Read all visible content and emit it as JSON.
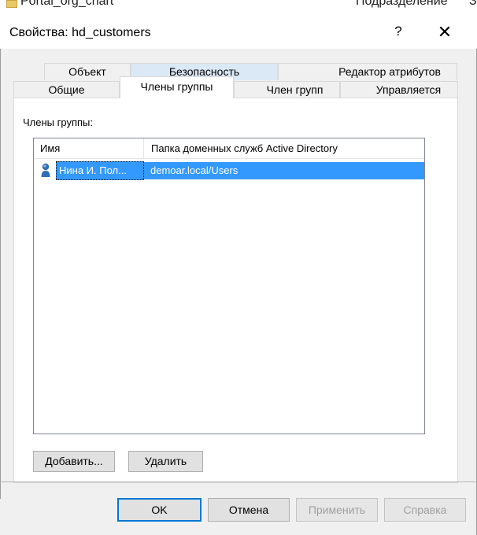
{
  "background_window": {
    "left_text": "Portal_org_chart",
    "right_text": "Подразделение",
    "right_text_2": "Зt"
  },
  "dialog": {
    "title": "Свойства: hd_customers",
    "help_label": "?",
    "close_label": "✕"
  },
  "tabs": {
    "row1": [
      {
        "label": "Объект"
      },
      {
        "label": "Безопасность"
      },
      {
        "label": "Редактор атрибутов"
      }
    ],
    "row2": [
      {
        "label": "Общие"
      },
      {
        "label": "Члены группы"
      },
      {
        "label": "Член групп"
      },
      {
        "label": "Управляется"
      }
    ],
    "active": "Члены группы"
  },
  "members": {
    "label": "Члены группы:",
    "columns": [
      "Имя",
      "Папка доменных служб Active Directory"
    ],
    "rows": [
      {
        "name": "Нина И. Пол...",
        "folder": "demoar.local/Users",
        "icon": "user-icon",
        "selected": true
      }
    ]
  },
  "buttons": {
    "add": "Добавить...",
    "remove": "Удалить",
    "ok": "OK",
    "cancel": "Отмена",
    "apply": "Применить",
    "help": "Справка"
  },
  "colors": {
    "selection": "#3399ff",
    "highlight_tab": "#dbe8f6",
    "default_button_border": "#0078d7"
  }
}
